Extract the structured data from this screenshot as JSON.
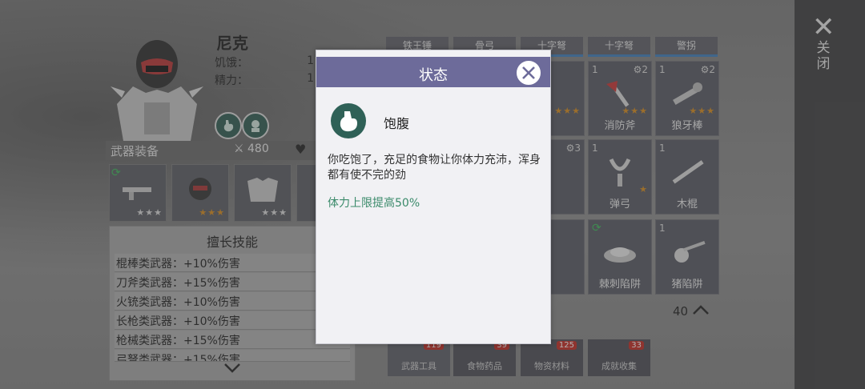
{
  "character": {
    "name": "尼克",
    "stats": [
      {
        "label": "饥饿：",
        "value": "1"
      },
      {
        "label": "精力：",
        "value": "1"
      }
    ]
  },
  "weapon_section": {
    "title": "武器装备",
    "attack": "480"
  },
  "skills": {
    "title": "擅长技能",
    "rows": [
      "棍棒类武器：+10%伤害",
      "刀斧类武器：+15%伤害",
      "火铳类武器：+10%伤害",
      "长枪类武器：+10%伤害",
      "枪械类武器：+15%伤害",
      "弓弩类武器：+15%伤害"
    ]
  },
  "inventory": {
    "top_tabs": [
      "铁王锤",
      "骨弓",
      "十字弩",
      "十字弩",
      "警拐"
    ],
    "row1": [
      {
        "name": "消防斧",
        "count": "1",
        "level": "2"
      },
      {
        "name": "狼牙棒",
        "count": "1",
        "level": "2"
      }
    ],
    "row2": [
      {
        "name": "弹弓",
        "count": "1"
      },
      {
        "name": "木棍",
        "count": "1"
      }
    ],
    "row3": [
      {
        "name": "棘刺陷阱"
      },
      {
        "name": "猪陷阱",
        "count": "1"
      }
    ],
    "fold_count": "40",
    "bottom_tabs": [
      {
        "label": "武器工具",
        "badge": "119"
      },
      {
        "label": "食物药品",
        "badge": "39"
      },
      {
        "label": "物资材料",
        "badge": "125"
      },
      {
        "label": "成就收集",
        "badge": "33"
      }
    ]
  },
  "right_panel": {
    "close_label": "关闭"
  },
  "modal": {
    "title": "状态",
    "status_name": "饱腹",
    "description": "你吃饱了，充足的食物让你体力充沛，浑身都有使不完的劲",
    "effect": "体力上限提高50%"
  },
  "colors": {
    "modal_header": "#6d6b9a",
    "effect_text": "#3a8a6a",
    "status_icon_bg": "#2f6157",
    "star": "#d98c1b",
    "badge": "#c4281f"
  }
}
